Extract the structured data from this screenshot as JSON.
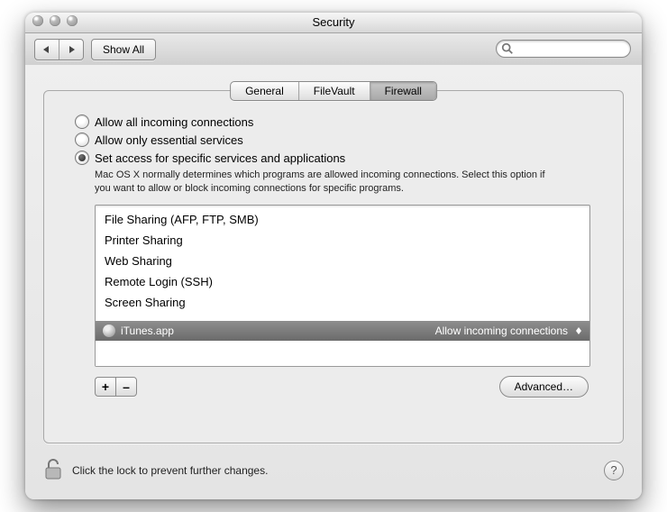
{
  "window": {
    "title": "Security"
  },
  "toolbar": {
    "show_all": "Show All",
    "search_placeholder": ""
  },
  "tabs": [
    {
      "label": "General"
    },
    {
      "label": "FileVault"
    },
    {
      "label": "Firewall"
    }
  ],
  "radios": {
    "allow_all": "Allow all incoming connections",
    "essential": "Allow only essential services",
    "specific": "Set access for specific services and applications"
  },
  "description": "Mac OS X normally determines which programs are allowed incoming connections. Select this option if you want to allow or block incoming connections for specific programs.",
  "services": [
    "File Sharing (AFP, FTP, SMB)",
    "Printer Sharing",
    "Web Sharing",
    "Remote Login (SSH)",
    "Screen Sharing"
  ],
  "selected_app": {
    "name": "iTunes.app",
    "setting": "Allow incoming connections"
  },
  "buttons": {
    "add": "+",
    "remove": "–",
    "advanced": "Advanced…"
  },
  "footer": {
    "lock_text": "Click the lock to prevent further changes.",
    "help": "?"
  }
}
